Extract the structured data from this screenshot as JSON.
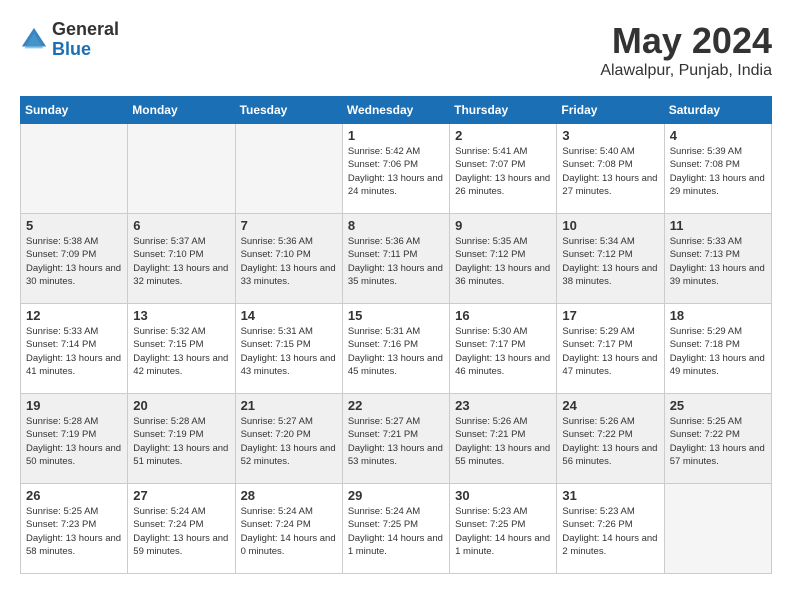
{
  "header": {
    "logo_general": "General",
    "logo_blue": "Blue",
    "month_title": "May 2024",
    "location": "Alawalpur, Punjab, India"
  },
  "days_of_week": [
    "Sunday",
    "Monday",
    "Tuesday",
    "Wednesday",
    "Thursday",
    "Friday",
    "Saturday"
  ],
  "weeks": [
    [
      {
        "day": "",
        "empty": true
      },
      {
        "day": "",
        "empty": true
      },
      {
        "day": "",
        "empty": true
      },
      {
        "day": "1",
        "sunrise": "Sunrise: 5:42 AM",
        "sunset": "Sunset: 7:06 PM",
        "daylight": "Daylight: 13 hours and 24 minutes."
      },
      {
        "day": "2",
        "sunrise": "Sunrise: 5:41 AM",
        "sunset": "Sunset: 7:07 PM",
        "daylight": "Daylight: 13 hours and 26 minutes."
      },
      {
        "day": "3",
        "sunrise": "Sunrise: 5:40 AM",
        "sunset": "Sunset: 7:08 PM",
        "daylight": "Daylight: 13 hours and 27 minutes."
      },
      {
        "day": "4",
        "sunrise": "Sunrise: 5:39 AM",
        "sunset": "Sunset: 7:08 PM",
        "daylight": "Daylight: 13 hours and 29 minutes."
      }
    ],
    [
      {
        "day": "5",
        "sunrise": "Sunrise: 5:38 AM",
        "sunset": "Sunset: 7:09 PM",
        "daylight": "Daylight: 13 hours and 30 minutes."
      },
      {
        "day": "6",
        "sunrise": "Sunrise: 5:37 AM",
        "sunset": "Sunset: 7:10 PM",
        "daylight": "Daylight: 13 hours and 32 minutes."
      },
      {
        "day": "7",
        "sunrise": "Sunrise: 5:36 AM",
        "sunset": "Sunset: 7:10 PM",
        "daylight": "Daylight: 13 hours and 33 minutes."
      },
      {
        "day": "8",
        "sunrise": "Sunrise: 5:36 AM",
        "sunset": "Sunset: 7:11 PM",
        "daylight": "Daylight: 13 hours and 35 minutes."
      },
      {
        "day": "9",
        "sunrise": "Sunrise: 5:35 AM",
        "sunset": "Sunset: 7:12 PM",
        "daylight": "Daylight: 13 hours and 36 minutes."
      },
      {
        "day": "10",
        "sunrise": "Sunrise: 5:34 AM",
        "sunset": "Sunset: 7:12 PM",
        "daylight": "Daylight: 13 hours and 38 minutes."
      },
      {
        "day": "11",
        "sunrise": "Sunrise: 5:33 AM",
        "sunset": "Sunset: 7:13 PM",
        "daylight": "Daylight: 13 hours and 39 minutes."
      }
    ],
    [
      {
        "day": "12",
        "sunrise": "Sunrise: 5:33 AM",
        "sunset": "Sunset: 7:14 PM",
        "daylight": "Daylight: 13 hours and 41 minutes."
      },
      {
        "day": "13",
        "sunrise": "Sunrise: 5:32 AM",
        "sunset": "Sunset: 7:15 PM",
        "daylight": "Daylight: 13 hours and 42 minutes."
      },
      {
        "day": "14",
        "sunrise": "Sunrise: 5:31 AM",
        "sunset": "Sunset: 7:15 PM",
        "daylight": "Daylight: 13 hours and 43 minutes."
      },
      {
        "day": "15",
        "sunrise": "Sunrise: 5:31 AM",
        "sunset": "Sunset: 7:16 PM",
        "daylight": "Daylight: 13 hours and 45 minutes."
      },
      {
        "day": "16",
        "sunrise": "Sunrise: 5:30 AM",
        "sunset": "Sunset: 7:17 PM",
        "daylight": "Daylight: 13 hours and 46 minutes."
      },
      {
        "day": "17",
        "sunrise": "Sunrise: 5:29 AM",
        "sunset": "Sunset: 7:17 PM",
        "daylight": "Daylight: 13 hours and 47 minutes."
      },
      {
        "day": "18",
        "sunrise": "Sunrise: 5:29 AM",
        "sunset": "Sunset: 7:18 PM",
        "daylight": "Daylight: 13 hours and 49 minutes."
      }
    ],
    [
      {
        "day": "19",
        "sunrise": "Sunrise: 5:28 AM",
        "sunset": "Sunset: 7:19 PM",
        "daylight": "Daylight: 13 hours and 50 minutes."
      },
      {
        "day": "20",
        "sunrise": "Sunrise: 5:28 AM",
        "sunset": "Sunset: 7:19 PM",
        "daylight": "Daylight: 13 hours and 51 minutes."
      },
      {
        "day": "21",
        "sunrise": "Sunrise: 5:27 AM",
        "sunset": "Sunset: 7:20 PM",
        "daylight": "Daylight: 13 hours and 52 minutes."
      },
      {
        "day": "22",
        "sunrise": "Sunrise: 5:27 AM",
        "sunset": "Sunset: 7:21 PM",
        "daylight": "Daylight: 13 hours and 53 minutes."
      },
      {
        "day": "23",
        "sunrise": "Sunrise: 5:26 AM",
        "sunset": "Sunset: 7:21 PM",
        "daylight": "Daylight: 13 hours and 55 minutes."
      },
      {
        "day": "24",
        "sunrise": "Sunrise: 5:26 AM",
        "sunset": "Sunset: 7:22 PM",
        "daylight": "Daylight: 13 hours and 56 minutes."
      },
      {
        "day": "25",
        "sunrise": "Sunrise: 5:25 AM",
        "sunset": "Sunset: 7:22 PM",
        "daylight": "Daylight: 13 hours and 57 minutes."
      }
    ],
    [
      {
        "day": "26",
        "sunrise": "Sunrise: 5:25 AM",
        "sunset": "Sunset: 7:23 PM",
        "daylight": "Daylight: 13 hours and 58 minutes."
      },
      {
        "day": "27",
        "sunrise": "Sunrise: 5:24 AM",
        "sunset": "Sunset: 7:24 PM",
        "daylight": "Daylight: 13 hours and 59 minutes."
      },
      {
        "day": "28",
        "sunrise": "Sunrise: 5:24 AM",
        "sunset": "Sunset: 7:24 PM",
        "daylight": "Daylight: 14 hours and 0 minutes."
      },
      {
        "day": "29",
        "sunrise": "Sunrise: 5:24 AM",
        "sunset": "Sunset: 7:25 PM",
        "daylight": "Daylight: 14 hours and 1 minute."
      },
      {
        "day": "30",
        "sunrise": "Sunrise: 5:23 AM",
        "sunset": "Sunset: 7:25 PM",
        "daylight": "Daylight: 14 hours and 1 minute."
      },
      {
        "day": "31",
        "sunrise": "Sunrise: 5:23 AM",
        "sunset": "Sunset: 7:26 PM",
        "daylight": "Daylight: 14 hours and 2 minutes."
      },
      {
        "day": "",
        "empty": true
      }
    ]
  ]
}
